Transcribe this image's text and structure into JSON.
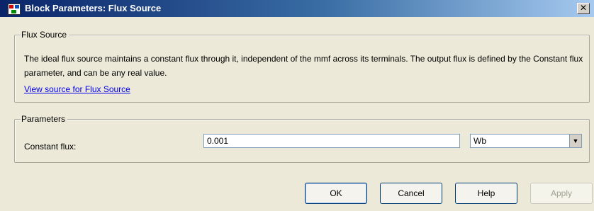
{
  "window": {
    "title": "Block Parameters: Flux Source",
    "close_symbol": "✕"
  },
  "description_group": {
    "legend": "Flux Source",
    "text": "The ideal flux source maintains a constant flux through it, independent of the mmf across its terminals. The output flux is defined by the Constant flux parameter, and can be any real value.",
    "link": "View source for Flux Source"
  },
  "parameters_group": {
    "legend": "Parameters",
    "constant_flux": {
      "label": "Constant flux:",
      "value": "0.001",
      "unit": "Wb"
    }
  },
  "buttons": {
    "ok": "OK",
    "cancel": "Cancel",
    "help": "Help",
    "apply": "Apply"
  },
  "icons": {
    "app": "simulink-block-icon",
    "close": "close-icon",
    "dropdown": "chevron-down-icon"
  }
}
